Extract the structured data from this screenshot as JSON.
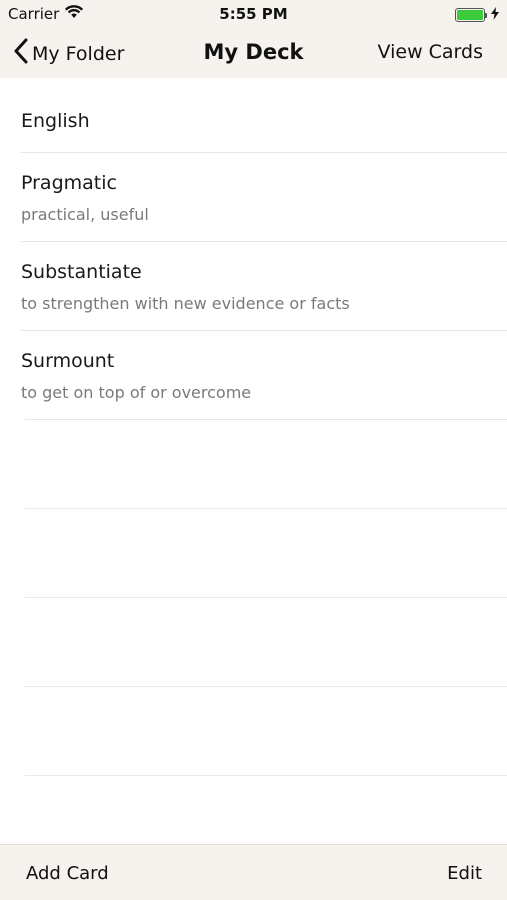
{
  "status_bar": {
    "carrier": "Carrier",
    "time": "5:55 PM",
    "wifi_icon": "wifi-icon",
    "battery_icon": "battery-icon",
    "charging_icon": "bolt-icon",
    "battery_color": "#3ccb3c"
  },
  "nav": {
    "back_label": "My Folder",
    "back_icon": "chevron-left-icon",
    "title": "My Deck",
    "right_label": "View Cards"
  },
  "list": {
    "items": [
      {
        "title": "English",
        "subtitle": ""
      },
      {
        "title": "Pragmatic",
        "subtitle": "practical, useful"
      },
      {
        "title": "Substantiate",
        "subtitle": "to strengthen with new evidence or facts"
      },
      {
        "title": "Surmount",
        "subtitle": "to get on top of or overcome"
      }
    ]
  },
  "toolbar": {
    "left_label": "Add Card",
    "right_label": "Edit"
  },
  "colors": {
    "bar_background": "#f6f3ef",
    "subtitle_text": "#7a7a7a",
    "separator": "#e6e6e6"
  }
}
